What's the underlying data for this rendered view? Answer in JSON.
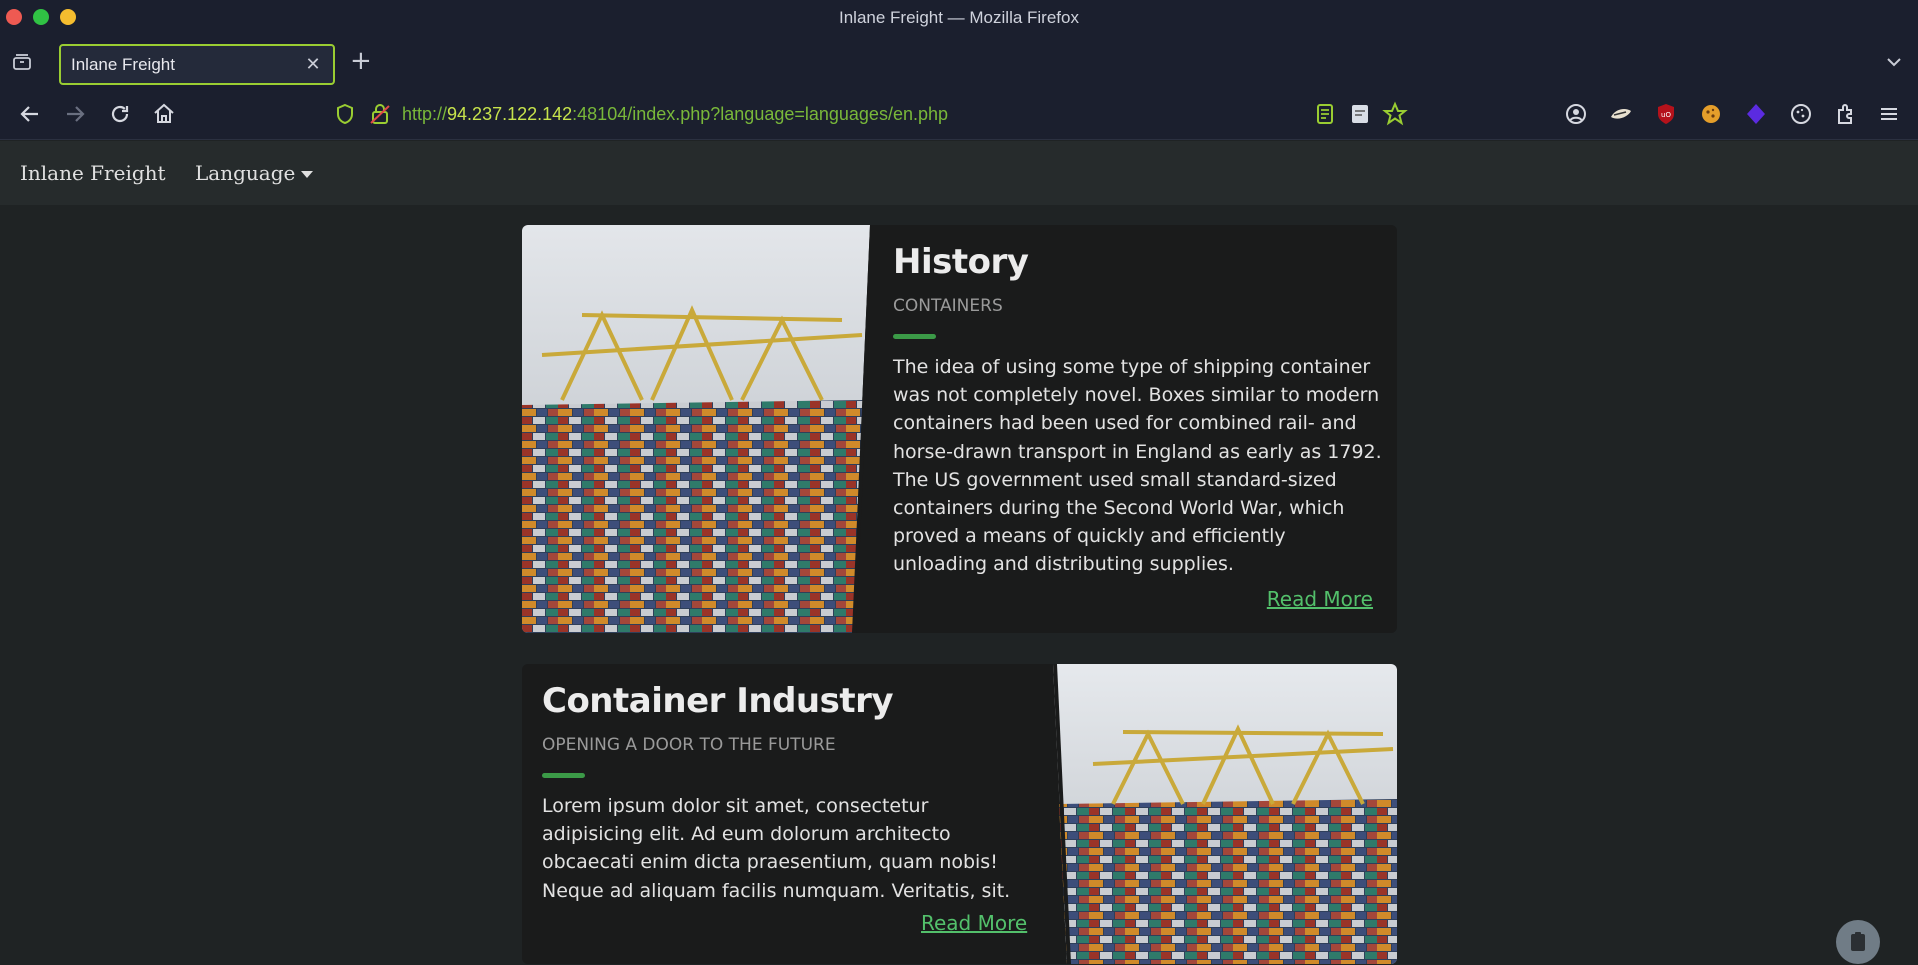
{
  "window": {
    "title": "Inlane Freight — Mozilla Firefox"
  },
  "tabs": [
    {
      "title": "Inlane Freight"
    }
  ],
  "url": {
    "protocol": "http://",
    "host": "94.237.122.142",
    "rest": ":48104/index.php?language=languages/en.php"
  },
  "site": {
    "brand": "Inlane Freight",
    "language_label": "Language"
  },
  "cards": [
    {
      "title": "History",
      "subtitle": "CONTAINERS",
      "text": "The idea of using some type of shipping container was not completely novel. Boxes similar to modern containers had been used for combined rail- and horse-drawn transport in England as early as 1792. The US government used small standard-sized containers during the Second World War, which proved a means of quickly and efficiently unloading and distributing supplies.",
      "link": "Read More"
    },
    {
      "title": "Container Industry",
      "subtitle": "OPENING A DOOR TO THE FUTURE",
      "text": "Lorem ipsum dolor sit amet, consectetur adipisicing elit. Ad eum dolorum architecto obcaecati enim dicta praesentium, quam nobis! Neque ad aliquam facilis numquam. Veritatis, sit.",
      "link": "Read More"
    }
  ],
  "colors": {
    "accent": "#3b9a47",
    "link": "#53c06b",
    "tab_border": "#9acd32"
  }
}
